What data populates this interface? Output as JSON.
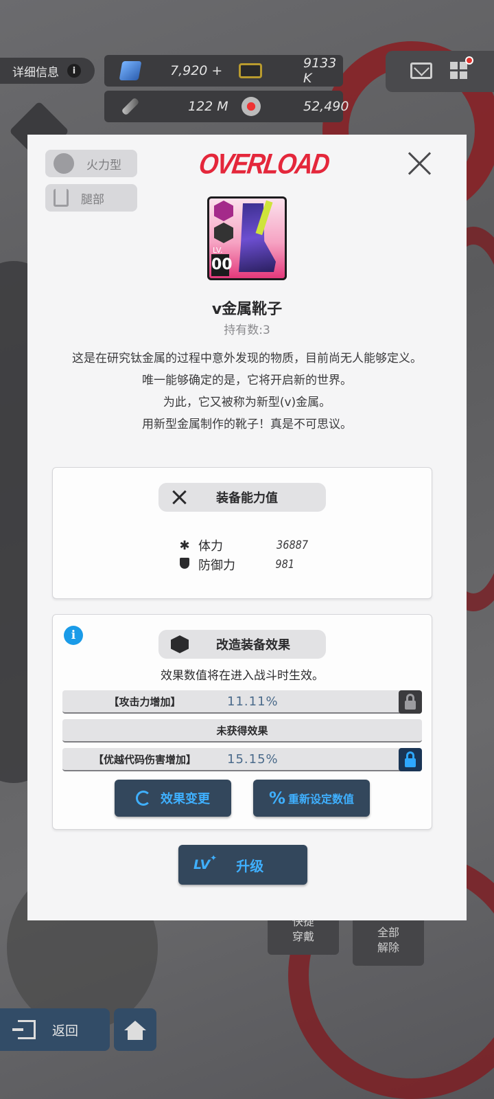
{
  "hud": {
    "detail_label": "详细信息",
    "resources": [
      {
        "name": "gem",
        "value": "7,920 +"
      },
      {
        "name": "credit",
        "value": "9133 K"
      },
      {
        "name": "core",
        "value": "122 M"
      },
      {
        "name": "crystal",
        "value": "52,490"
      }
    ],
    "has_notification": true
  },
  "background_buttons": {
    "quick_equip": "快捷\n穿戴",
    "unequip_all": "全部\n解除",
    "return": "返回"
  },
  "modal": {
    "tags": {
      "type": "火力型",
      "slot": "腿部"
    },
    "brand": "OVERLOAD",
    "item": {
      "level_label": "LV.",
      "level_value": "00",
      "name": "v金属靴子",
      "owned_label": "持有数:",
      "owned_count": "3",
      "description": [
        "这是在研究钛金属的过程中意外发现的物质，目前尚无人能够定义。",
        "唯一能够确定的是，它将开启新的世界。",
        "为此，它又被称为新型(v)金属。",
        "用新型金属制作的靴子！真是不可思议。"
      ]
    },
    "stats_panel": {
      "title": "装备能力值",
      "stats": [
        {
          "icon": "asterisk-icon",
          "label": "体力",
          "value": "36887"
        },
        {
          "icon": "shield-icon",
          "label": "防御力",
          "value": "981"
        }
      ]
    },
    "mods_panel": {
      "title": "改造装备效果",
      "note": "效果数值将在进入战斗时生效。",
      "effects": [
        {
          "name": "【攻击力增加】",
          "value": "11.11%",
          "locked": false
        },
        {
          "name": "未获得效果",
          "value": "",
          "locked": null
        },
        {
          "name": "【优越代码伤害增加】",
          "value": "15.15%",
          "locked": true
        }
      ],
      "change_button": "效果变更",
      "reset_button": "重新设定数值"
    },
    "upgrade": {
      "lv_label": "LV",
      "label": "升级"
    }
  },
  "colors": {
    "accent_blue": "#3fb0ff",
    "brand_red": "#e4273b",
    "button_bg": "#33475c"
  }
}
